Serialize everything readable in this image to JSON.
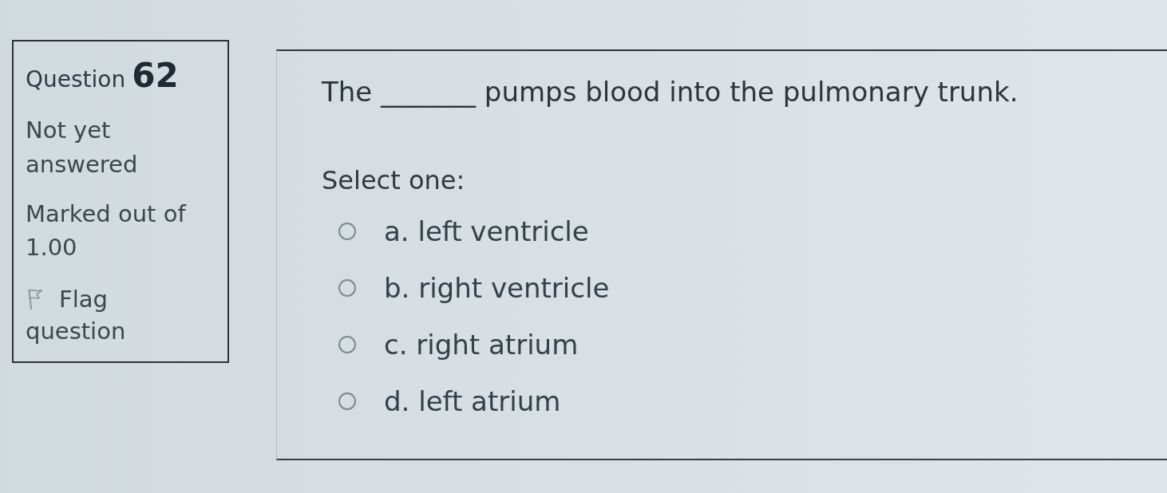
{
  "question_info": {
    "label": "Question",
    "number": "62",
    "state": "Not yet answered",
    "grade": "Marked out of 1.00",
    "flag": {
      "label": "Flag question",
      "flagged": false
    }
  },
  "question": {
    "text": "The _______ pumps blood into the pulmonary trunk.",
    "prompt": "Select one:",
    "options": [
      {
        "label": "a. left ventricle",
        "selected": false
      },
      {
        "label": "b. right ventricle",
        "selected": false
      },
      {
        "label": "c. right atrium",
        "selected": false
      },
      {
        "label": "d. left atrium",
        "selected": false
      }
    ]
  }
}
